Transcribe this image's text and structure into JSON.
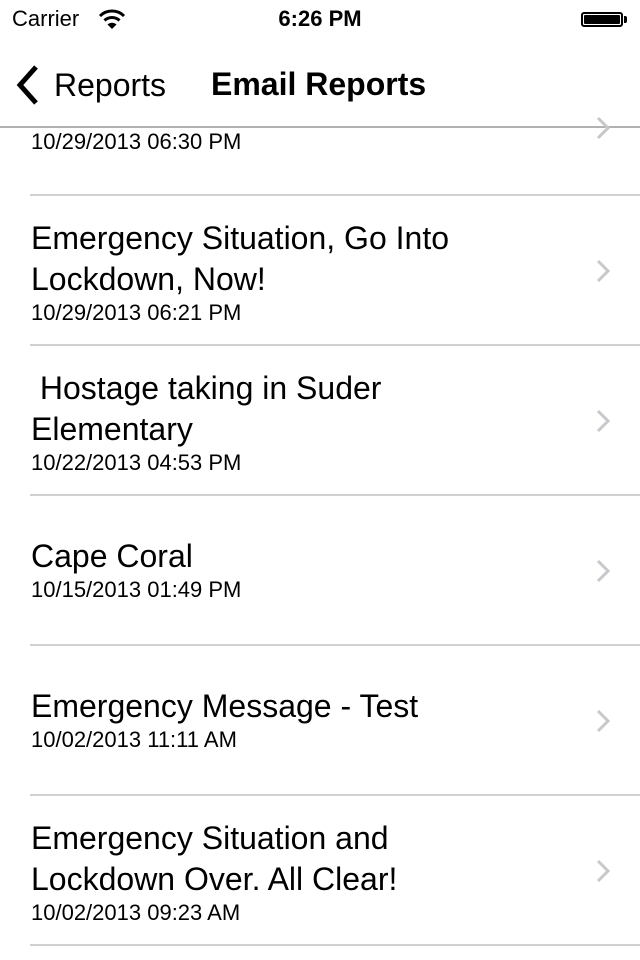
{
  "status_bar": {
    "carrier": "Carrier",
    "wifi_icon": "wifi-icon",
    "time": "6:26 PM",
    "battery_icon": "battery-full-icon",
    "battery_level_percent": 100
  },
  "nav_bar": {
    "back_icon": "chevron-left-icon",
    "back_label": "Reports",
    "title": "Email Reports"
  },
  "reports": [
    {
      "title": "",
      "date": "10/29/2013 06:30 PM"
    },
    {
      "title": "Emergency Situation, Go Into\nLockdown, Now!",
      "date": "10/29/2013 06:21 PM"
    },
    {
      "title": " Hostage taking in Suder\nElementary",
      "date": "10/22/2013 04:53 PM"
    },
    {
      "title": "Cape Coral",
      "date": "10/15/2013 01:49 PM"
    },
    {
      "title": "Emergency Message - Test",
      "date": "10/02/2013 11:11 AM"
    },
    {
      "title": "Emergency Situation and\nLockdown Over. All Clear!",
      "date": "10/02/2013 09:23 AM"
    }
  ],
  "colors": {
    "separator": "#d0d0d3",
    "chevron": "#c7c7cc",
    "nav_border": "#b2b2b2"
  }
}
